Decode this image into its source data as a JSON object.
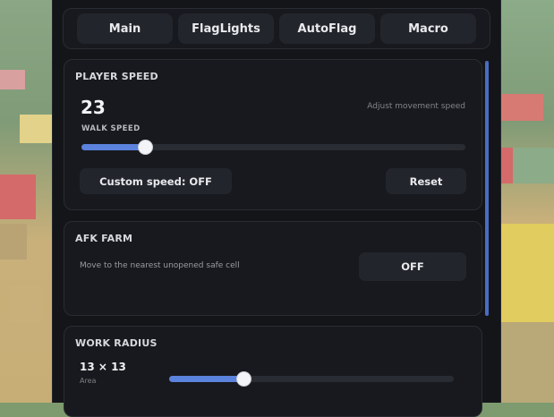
{
  "tabs": [
    {
      "label": "Main"
    },
    {
      "label": "FlagLights"
    },
    {
      "label": "AutoFlag"
    },
    {
      "label": "Macro"
    }
  ],
  "player_speed": {
    "title": "PLAYER SPEED",
    "value": "23",
    "hint": "Adjust movement speed",
    "slider_label": "WALK SPEED",
    "slider_fraction": 0.165,
    "custom_button": "Custom speed: OFF",
    "reset_button": "Reset"
  },
  "afk_farm": {
    "title": "AFK FARM",
    "description": "Move to the nearest unopened safe cell",
    "toggle": "OFF"
  },
  "work_radius": {
    "title": "WORK RADIUS",
    "value": "13 × 13",
    "label": "Area",
    "slider_fraction": 0.26
  },
  "colors": {
    "accent": "#5b82dc",
    "panel": "#141519",
    "card": "#18191e"
  }
}
